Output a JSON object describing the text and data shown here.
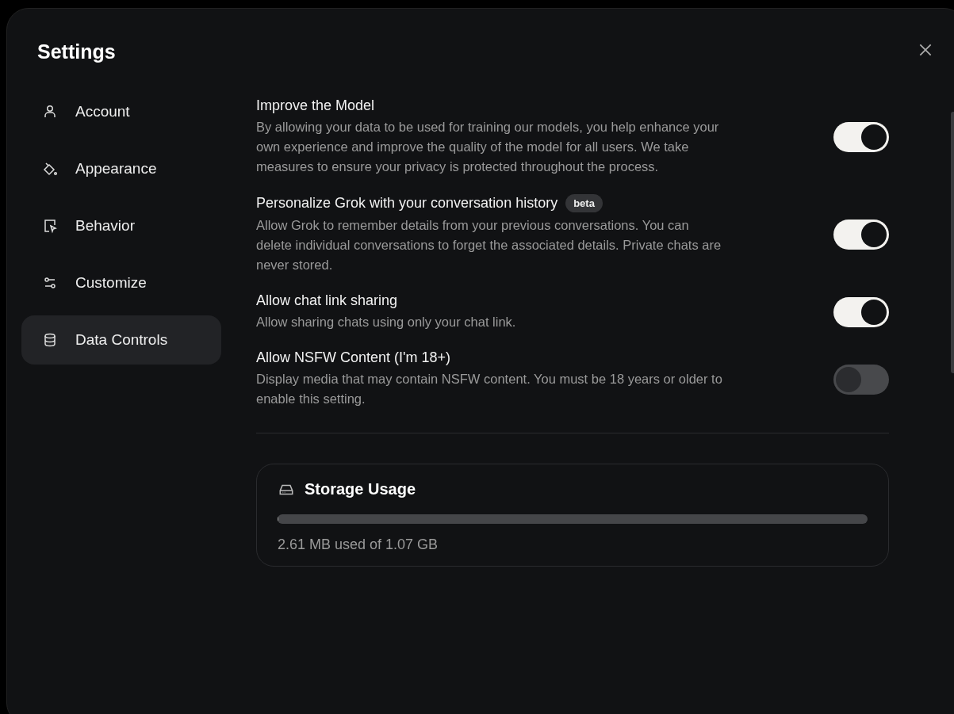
{
  "dialog": {
    "title": "Settings"
  },
  "sidebar": {
    "items": [
      {
        "label": "Account",
        "selected": false
      },
      {
        "label": "Appearance",
        "selected": false
      },
      {
        "label": "Behavior",
        "selected": false
      },
      {
        "label": "Customize",
        "selected": false
      },
      {
        "label": "Data Controls",
        "selected": true
      }
    ]
  },
  "settings": [
    {
      "title": "Improve the Model",
      "description": "By allowing your data to be used for training our models, you help enhance your own experience and improve the quality of the model for all users. We take measures to ensure your privacy is protected throughout the process.",
      "on": true
    },
    {
      "title": "Personalize Grok with your conversation history",
      "badge": "beta",
      "description": "Allow Grok to remember details from your previous conversations. You can delete individual conversations to forget the associated details. Private chats are never stored.",
      "on": true
    },
    {
      "title": "Allow chat link sharing",
      "description": "Allow sharing chats using only your chat link.",
      "on": true
    },
    {
      "title": "Allow NSFW Content (I'm 18+)",
      "description": "Display media that may contain NSFW content. You must be 18 years or older to enable this setting.",
      "on": false
    }
  ],
  "storage": {
    "title": "Storage Usage",
    "level": 0.002,
    "reading": "2.61 MB used of 1.07 GB"
  }
}
